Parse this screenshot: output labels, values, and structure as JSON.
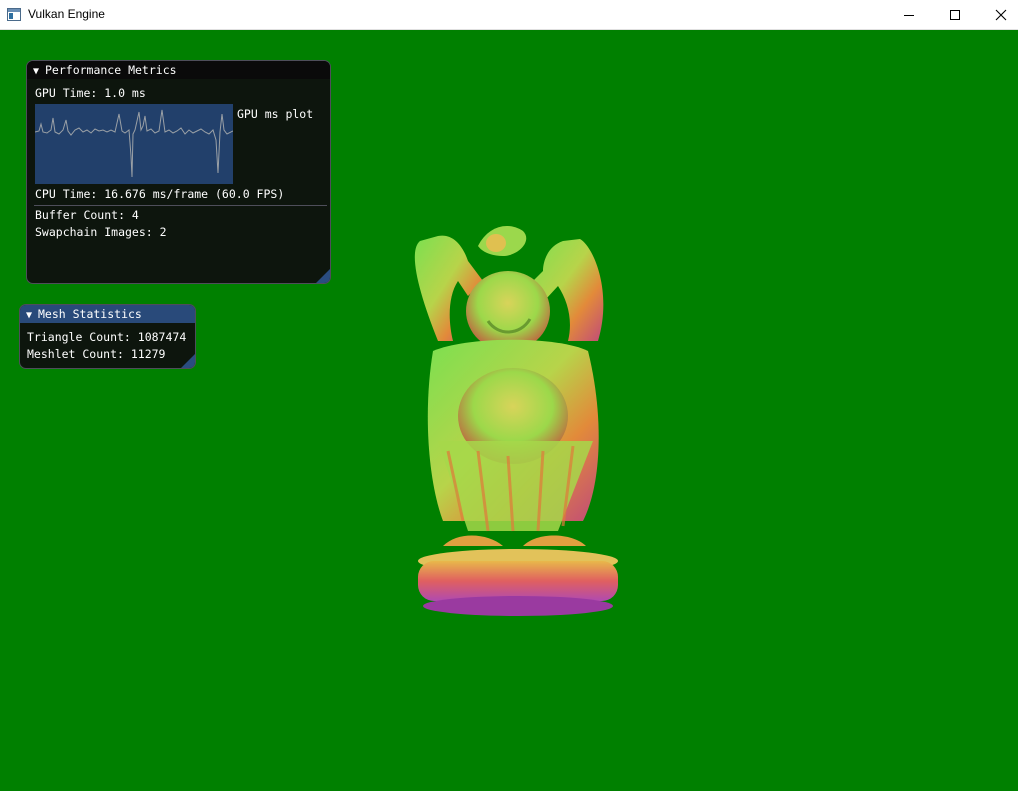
{
  "window": {
    "title": "Vulkan Engine",
    "icon": "app-window-icon",
    "controls": {
      "minimize": "minimize-icon",
      "maximize": "maximize-icon",
      "close": "close-icon"
    }
  },
  "viewport": {
    "background": "#008000",
    "model": "buddha-statue-normal-shaded"
  },
  "performance": {
    "title": "Performance Metrics",
    "gpu_time": "GPU Time: 1.0 ms",
    "plot_label": "GPU ms plot",
    "cpu_time": "CPU Time: 16.676 ms/frame (60.0 FPS)",
    "buffer_count": "Buffer Count: 4",
    "swapchain_images": "Swapchain Images: 2"
  },
  "mesh": {
    "title": "Mesh Statistics",
    "triangle_count": "Triangle Count: 1087474",
    "meshlet_count": "Meshlet Count: 11279"
  },
  "colors": {
    "background": "#008000",
    "title_active": "#294a7a",
    "plot_bg": "#22406b",
    "plot_line": "#9aa0a6"
  }
}
